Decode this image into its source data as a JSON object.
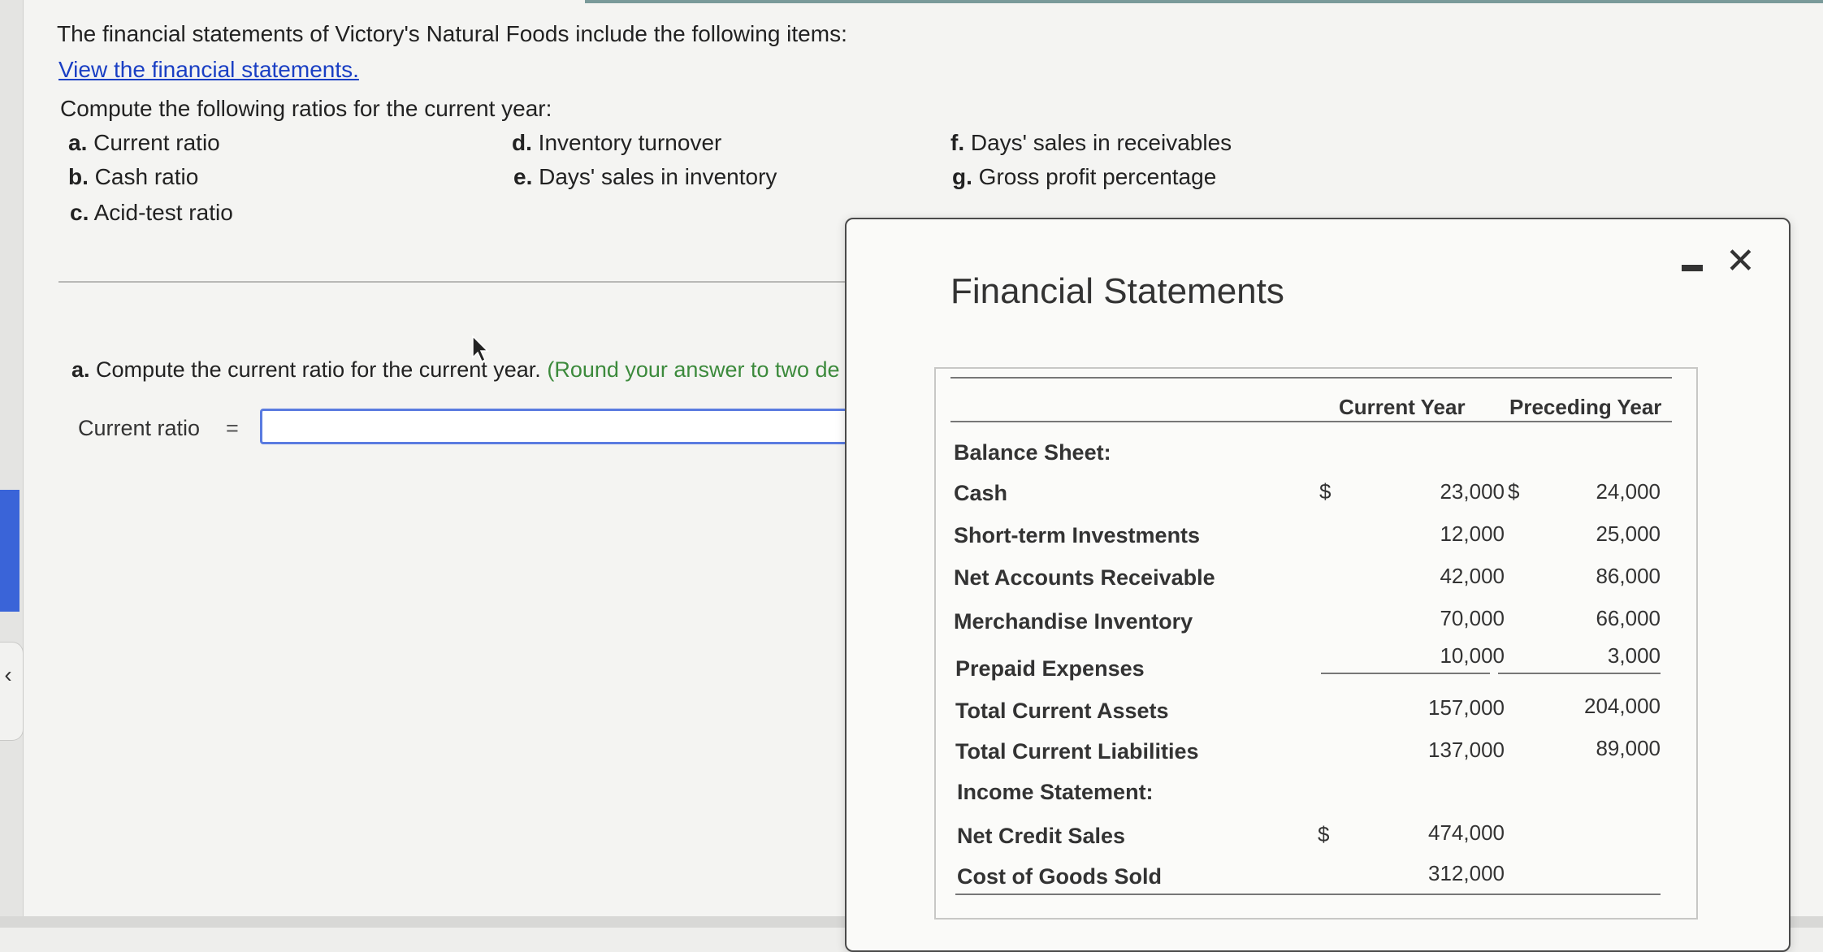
{
  "intro": "The financial statements of Victory's Natural Foods include the following items:",
  "view_link": "View the financial statements.",
  "compute_prompt": "Compute the following ratios for the current year:",
  "ratios": {
    "a": {
      "letter": "a.",
      "text": "Current ratio"
    },
    "b": {
      "letter": "b.",
      "text": "Cash ratio"
    },
    "c": {
      "letter": "c.",
      "text": "Acid-test ratio"
    },
    "d": {
      "letter": "d.",
      "text": "Inventory turnover"
    },
    "e": {
      "letter": "e.",
      "text": "Days' sales in inventory"
    },
    "f": {
      "letter": "f.",
      "text": "Days' sales in receivables"
    },
    "g": {
      "letter": "g.",
      "text": "Gross profit percentage"
    }
  },
  "question": {
    "letter": "a.",
    "text": "Compute the current ratio for the current year.",
    "hint": "(Round your answer to two de"
  },
  "current_ratio": {
    "label": "Current ratio",
    "equals": "=",
    "value": ""
  },
  "modal": {
    "title": "Financial Statements",
    "minimize_icon": "minimize-icon",
    "close_icon": "close-icon",
    "close_glyph": "✕",
    "columns": {
      "current": "Current Year",
      "preceding": "Preceding Year"
    },
    "dollar": "$",
    "rows": {
      "balance_sheet": "Balance Sheet:",
      "cash": {
        "label": "Cash",
        "current": "23,000",
        "preceding": "24,000"
      },
      "sti": {
        "label": "Short-term Investments",
        "current": "12,000",
        "preceding": "25,000"
      },
      "nar": {
        "label": "Net Accounts Receivable",
        "current": "42,000",
        "preceding": "86,000"
      },
      "inv": {
        "label": "Merchandise Inventory",
        "current": "70,000",
        "preceding": "66,000"
      },
      "prepaid": {
        "label": "Prepaid Expenses",
        "current": "10,000",
        "preceding": "3,000"
      },
      "tca": {
        "label": "Total Current Assets",
        "current": "157,000",
        "preceding": "204,000"
      },
      "tcl": {
        "label": "Total Current Liabilities",
        "current": "137,000",
        "preceding": "89,000"
      },
      "income_statement": "Income Statement:",
      "ncs": {
        "label": "Net Credit Sales",
        "current": "474,000"
      },
      "cogs": {
        "label": "Cost of Goods Sold",
        "current": "312,000"
      }
    }
  },
  "colors": {
    "link": "#1a3fc4",
    "hint": "#3c8a3c",
    "input_border": "#5a7be0",
    "left_accent": "#3a64d8"
  }
}
